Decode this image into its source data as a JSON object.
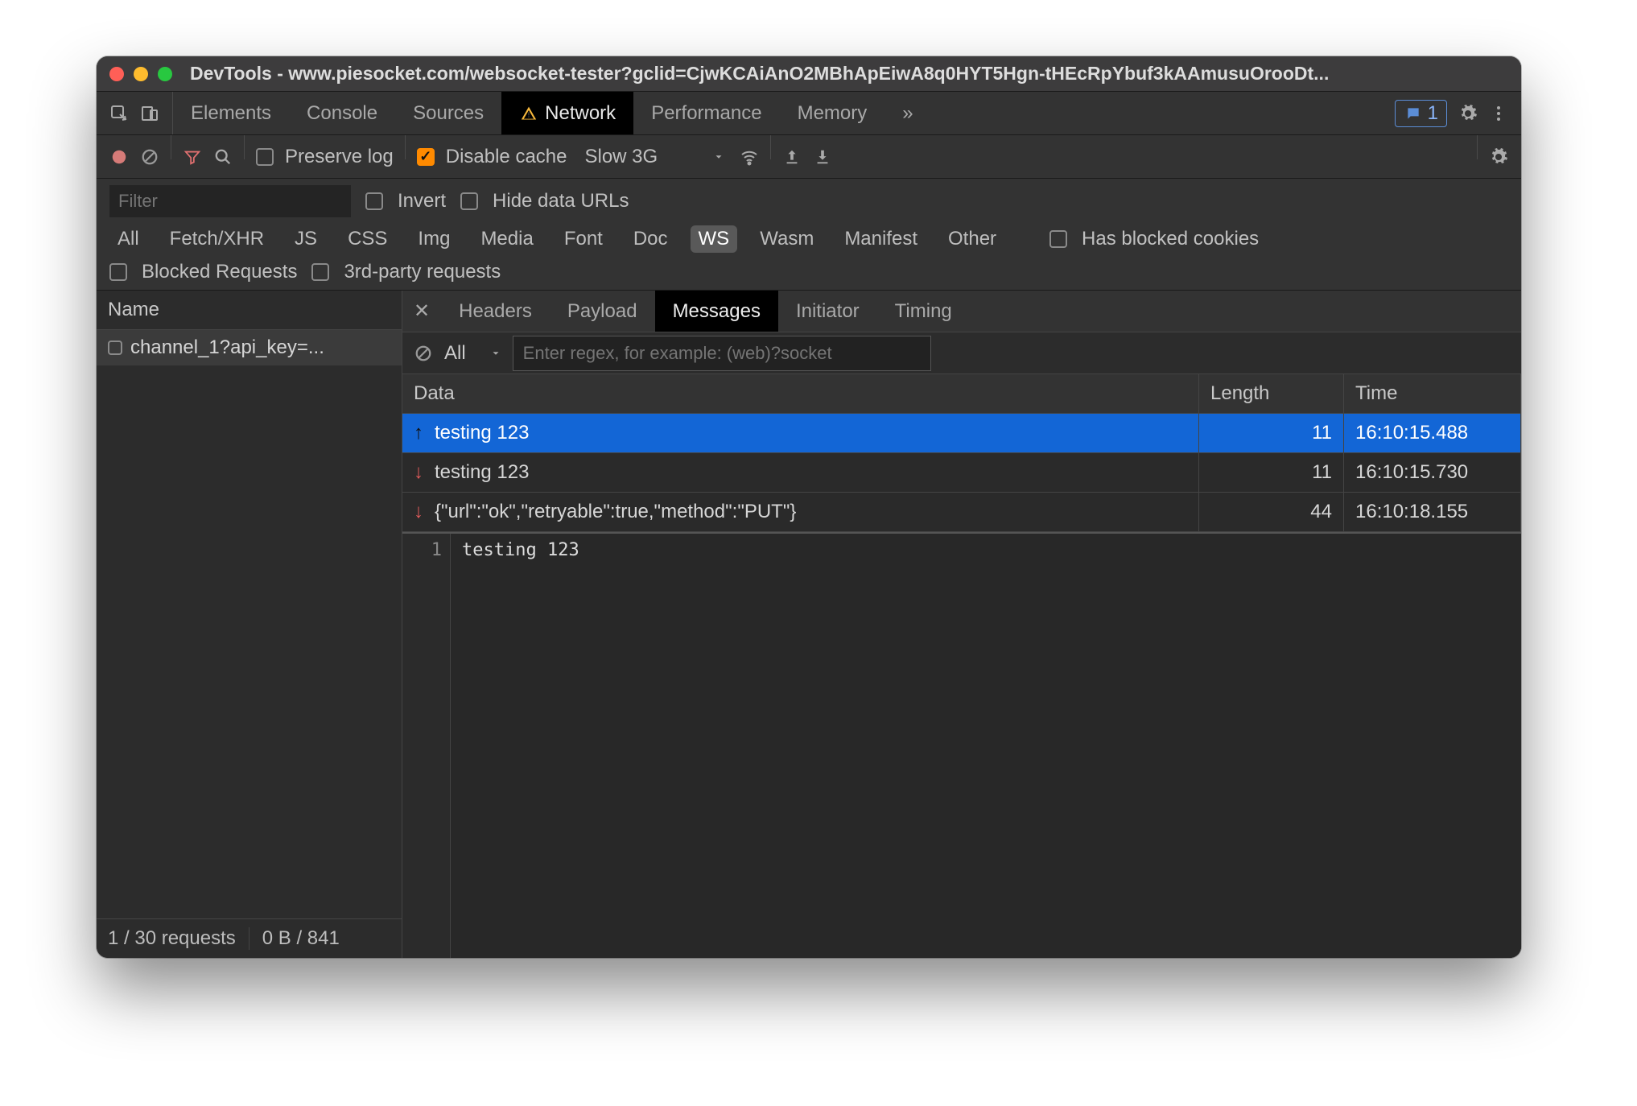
{
  "window": {
    "title": "DevTools - www.piesocket.com/websocket-tester?gclid=CjwKCAiAnO2MBhApEiwA8q0HYT5Hgn-tHEcRpYbuf3kAAmusuOrooDt..."
  },
  "tabs": {
    "items": [
      "Elements",
      "Console",
      "Sources",
      "Network",
      "Performance",
      "Memory"
    ],
    "active": "Network",
    "issues_count": "1"
  },
  "toolbar": {
    "preserve_log": "Preserve log",
    "disable_cache": "Disable cache",
    "throttle": "Slow 3G"
  },
  "filter": {
    "placeholder": "Filter",
    "invert": "Invert",
    "hide_data_urls": "Hide data URLs",
    "types": [
      "All",
      "Fetch/XHR",
      "JS",
      "CSS",
      "Img",
      "Media",
      "Font",
      "Doc",
      "WS",
      "Wasm",
      "Manifest",
      "Other"
    ],
    "selected_type": "WS",
    "has_blocked_cookies": "Has blocked cookies",
    "blocked_requests": "Blocked Requests",
    "third_party": "3rd-party requests"
  },
  "sidebar": {
    "header": "Name",
    "requests": [
      {
        "name": "channel_1?api_key=..."
      }
    ],
    "footer_requests": "1 / 30 requests",
    "footer_transfer": "0 B / 841"
  },
  "subtabs": {
    "items": [
      "Headers",
      "Payload",
      "Messages",
      "Initiator",
      "Timing"
    ],
    "active": "Messages"
  },
  "messages": {
    "filter_all": "All",
    "regex_placeholder": "Enter regex, for example: (web)?socket",
    "columns": {
      "data": "Data",
      "length": "Length",
      "time": "Time"
    },
    "rows": [
      {
        "dir": "up",
        "data": "testing 123",
        "length": "11",
        "time": "16:10:15.488",
        "selected": true
      },
      {
        "dir": "down",
        "data": "testing 123",
        "length": "11",
        "time": "16:10:15.730",
        "selected": false
      },
      {
        "dir": "down",
        "data": "{\"url\":\"ok\",\"retryable\":true,\"method\":\"PUT\"}",
        "length": "44",
        "time": "16:10:18.155",
        "selected": false
      }
    ],
    "detail": {
      "line": "1",
      "text": "testing 123"
    }
  }
}
